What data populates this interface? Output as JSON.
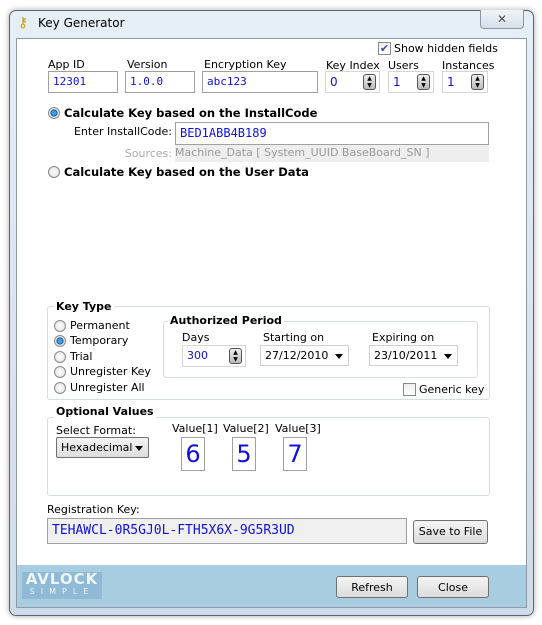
{
  "window": {
    "title": "Key Generator",
    "close_icon": "x-icon"
  },
  "show_hidden": {
    "label": "Show hidden fields",
    "checked": true
  },
  "fields": {
    "app_id": {
      "label": "App ID",
      "value": "12301"
    },
    "version": {
      "label": "Version",
      "value": "1.0.0"
    },
    "encryption_key": {
      "label": "Encryption Key",
      "value": "abc123"
    },
    "key_index": {
      "label": "Key Index",
      "value": "0"
    },
    "users": {
      "label": "Users",
      "value": "1"
    },
    "instances": {
      "label": "Instances",
      "value": "1"
    }
  },
  "mode_install": {
    "label": "Calculate Key based on the InstallCode",
    "selected": true,
    "installcode_label": "Enter InstallCode:",
    "installcode_value": "BED1ABB4B189",
    "sources_label": "Sources:",
    "sources_value": "Machine_Data [ System_UUID BaseBoard_SN ]"
  },
  "mode_user": {
    "label": "Calculate Key based on the User Data",
    "selected": false
  },
  "key_type": {
    "title": "Key Type",
    "options": [
      "Permanent",
      "Temporary",
      "Trial",
      "Unregister Key",
      "Unregister All"
    ],
    "selected": "Temporary"
  },
  "period": {
    "title": "Authorized Period",
    "days_label": "Days",
    "days": "300",
    "start_label": "Starting on",
    "start": "27/12/2010",
    "expire_label": "Expiring on",
    "expire": "23/10/2011"
  },
  "generic_key": {
    "label": "Generic key",
    "checked": false
  },
  "optional": {
    "title": "Optional Values",
    "format_label": "Select Format:",
    "format": "Hexadecimal",
    "values": [
      {
        "label": "Value[1]",
        "value": "6"
      },
      {
        "label": "Value[2]",
        "value": "5"
      },
      {
        "label": "Value[3]",
        "value": "7"
      }
    ]
  },
  "registration": {
    "label": "Registration Key:",
    "value": "TEHAWCL-0R5GJ0L-FTH5X6X-9G5R3UD",
    "save_label": "Save to File"
  },
  "footer": {
    "logo_top": "AVLOCK",
    "logo_bottom": "SIMPLE",
    "refresh_label": "Refresh",
    "close_label": "Close"
  },
  "colors": {
    "value_text": "#1010e0",
    "footer": "#a9cde0"
  }
}
